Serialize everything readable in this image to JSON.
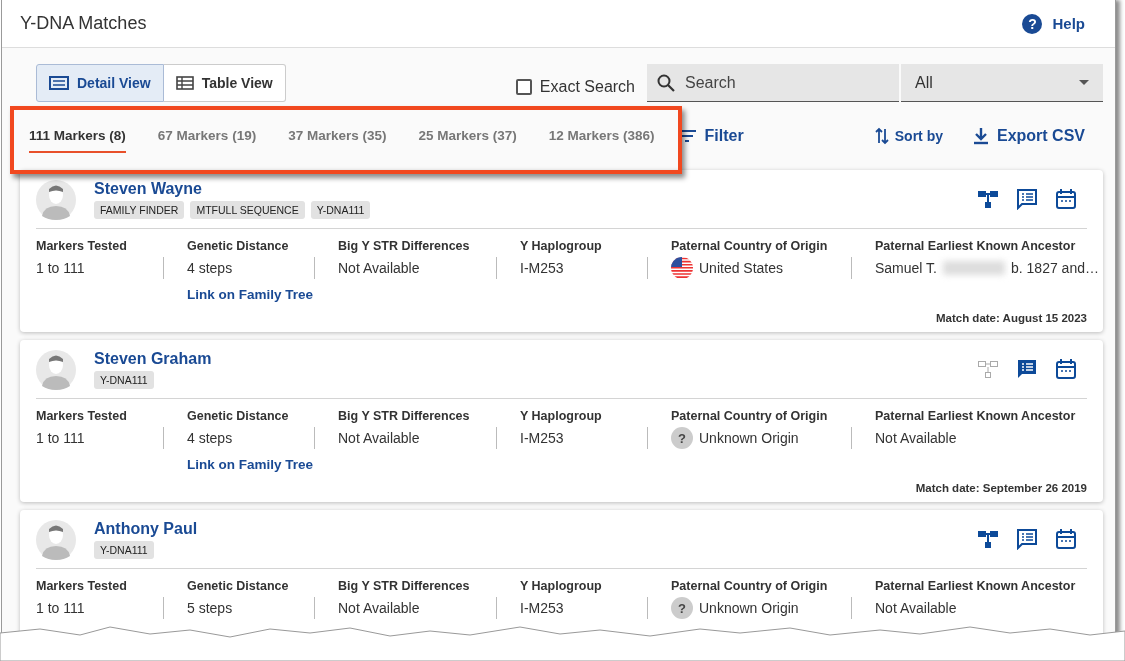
{
  "window": {
    "title": "Y-DNA Matches",
    "help": {
      "icon": "?",
      "label": "Help"
    }
  },
  "view_toggle": [
    {
      "label": "Detail View",
      "kind": "detail",
      "selected": true
    },
    {
      "label": "Table View",
      "kind": "table",
      "selected": false
    }
  ],
  "exact_search": {
    "label": "Exact Search",
    "checked": false
  },
  "search": {
    "placeholder": "Search"
  },
  "scope_select": {
    "value": "All"
  },
  "marker_tabs": [
    {
      "label": "111 Markers (8)",
      "selected": true
    },
    {
      "label": "67 Markers (19)",
      "selected": false
    },
    {
      "label": "37 Markers (35)",
      "selected": false
    },
    {
      "label": "25 Markers (37)",
      "selected": false
    },
    {
      "label": "12 Markers (386)",
      "selected": false
    }
  ],
  "filter": "Filter",
  "sort": "Sort by",
  "export": "Export CSV",
  "matches": [
    {
      "name": "Steven Wayne",
      "tags": [
        "FAMILY FINDER",
        "MTFULL SEQUENCE",
        "Y-DNA111"
      ],
      "actions": [
        {
          "kind": "tree",
          "disabled": false
        },
        {
          "kind": "notes",
          "disabled": false
        },
        {
          "kind": "calendar",
          "disabled": false
        }
      ],
      "fields": [
        {
          "label": "Markers Tested",
          "value": "1 to 111"
        },
        {
          "label": "Genetic Distance",
          "value": "4 steps",
          "link": "Link on Family Tree"
        },
        {
          "label": "Big Y STR Differences",
          "value": "Not Available"
        },
        {
          "label": "Y Haplogroup",
          "value": "I-M253"
        },
        {
          "label": "Paternal Country of Origin",
          "value": "United States",
          "icon": {
            "kind": "flag"
          }
        },
        {
          "label": "Paternal Earliest Known Ancestor",
          "value": "Samuel T.",
          "value_after_redaction": "b. 1827 and…"
        }
      ],
      "match_date": "Match date: August 15 2023"
    },
    {
      "name": "Steven Graham",
      "tags": [
        "Y-DNA111"
      ],
      "actions": [
        {
          "kind": "tree",
          "disabled": true
        },
        {
          "kind": "notes",
          "disabled": false
        },
        {
          "kind": "calendar",
          "disabled": false
        }
      ],
      "fields": [
        {
          "label": "Markers Tested",
          "value": "1 to 111"
        },
        {
          "label": "Genetic Distance",
          "value": "4 steps",
          "link": "Link on Family Tree"
        },
        {
          "label": "Big Y STR Differences",
          "value": "Not Available"
        },
        {
          "label": "Y Haplogroup",
          "value": "I-M253"
        },
        {
          "label": "Paternal Country of Origin",
          "value": "Unknown Origin",
          "icon": {
            "kind": "unknown",
            "glyph": "?"
          }
        },
        {
          "label": "Paternal Earliest Known Ancestor",
          "value": "Not Available"
        }
      ],
      "match_date": "Match date: September 26 2019"
    },
    {
      "name": "Anthony Paul",
      "tags": [
        "Y-DNA111"
      ],
      "actions": [
        {
          "kind": "tree",
          "disabled": false
        },
        {
          "kind": "notes",
          "disabled": false
        },
        {
          "kind": "calendar",
          "disabled": false
        }
      ],
      "fields": [
        {
          "label": "Markers Tested",
          "value": "1 to 111"
        },
        {
          "label": "Genetic Distance",
          "value": "5 steps"
        },
        {
          "label": "Big Y STR Differences",
          "value": "Not Available"
        },
        {
          "label": "Y Haplogroup",
          "value": "I-M253"
        },
        {
          "label": "Paternal Country of Origin",
          "value": "Unknown Origin",
          "icon": {
            "kind": "unknown",
            "glyph": "?"
          }
        },
        {
          "label": "Paternal Earliest Known Ancestor",
          "value": "Not Available"
        }
      ]
    }
  ]
}
